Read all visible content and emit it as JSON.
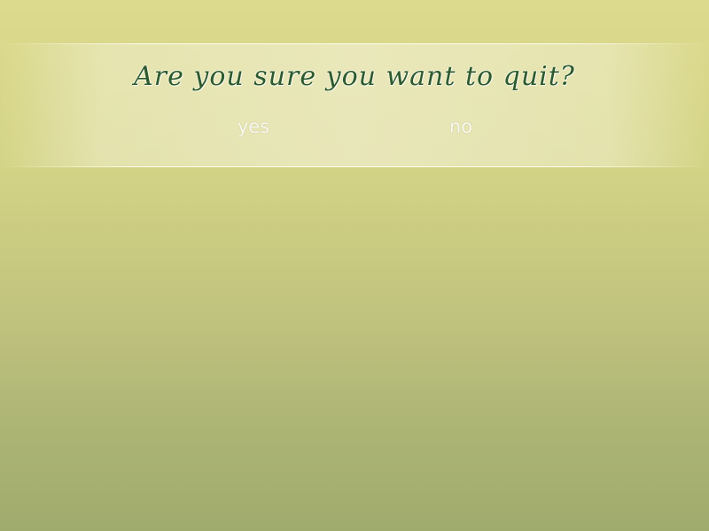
{
  "dialog": {
    "prompt": "Are you sure you want to quit?",
    "yes_label": "yes",
    "no_label": "no"
  },
  "colors": {
    "prompt_text": "#2d5a2c",
    "choice_text": "#f8f8ec",
    "background_top": "#dcda8c",
    "background_bottom": "#9fab6d"
  }
}
